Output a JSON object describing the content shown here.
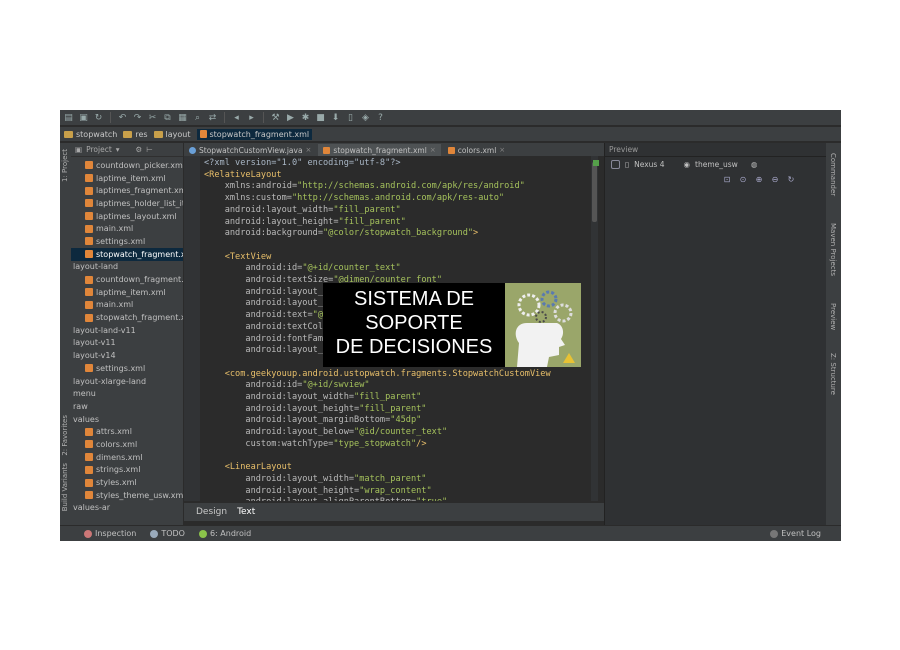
{
  "toolbar": {
    "icons": [
      "folder-icon",
      "save-icon",
      "sync-icon",
      "undo-icon",
      "redo-icon",
      "cut-icon",
      "copy-icon",
      "paste-icon",
      "find-icon",
      "replace-icon",
      "back-icon",
      "forward-icon",
      "build-icon",
      "run-icon",
      "debug-icon",
      "stop-icon",
      "sdk-icon",
      "avd-icon",
      "gradle-icon",
      "help-icon"
    ]
  },
  "breadcrumb": {
    "items": [
      "stopwatch",
      "res",
      "layout",
      "stopwatch_fragment.xml"
    ]
  },
  "left_tabs": {
    "project": "1: Project",
    "favorites": "2: Favorites",
    "build_variants": "Build Variants"
  },
  "project_panel": {
    "title": "Project",
    "items": [
      {
        "label": "countdown_picker.xml",
        "type": "file"
      },
      {
        "label": "laptime_item.xml",
        "type": "file"
      },
      {
        "label": "laptimes_fragment.xml",
        "type": "file"
      },
      {
        "label": "laptimes_holder_list_ite",
        "type": "file"
      },
      {
        "label": "laptimes_layout.xml",
        "type": "file"
      },
      {
        "label": "main.xml",
        "type": "file"
      },
      {
        "label": "settings.xml",
        "type": "file"
      },
      {
        "label": "stopwatch_fragment.xr",
        "type": "file",
        "selected": true
      },
      {
        "label": "layout-land",
        "type": "folder"
      },
      {
        "label": "countdown_fragment.x",
        "type": "file"
      },
      {
        "label": "laptime_item.xml",
        "type": "file"
      },
      {
        "label": "main.xml",
        "type": "file"
      },
      {
        "label": "stopwatch_fragment.xr",
        "type": "file"
      },
      {
        "label": "layout-land-v11",
        "type": "folder"
      },
      {
        "label": "layout-v11",
        "type": "folder"
      },
      {
        "label": "layout-v14",
        "type": "folder"
      },
      {
        "label": "settings.xml",
        "type": "file"
      },
      {
        "label": "layout-xlarge-land",
        "type": "folder"
      },
      {
        "label": "menu",
        "type": "folder"
      },
      {
        "label": "raw",
        "type": "folder"
      },
      {
        "label": "values",
        "type": "folder"
      },
      {
        "label": "attrs.xml",
        "type": "file"
      },
      {
        "label": "colors.xml",
        "type": "file"
      },
      {
        "label": "dimens.xml",
        "type": "file"
      },
      {
        "label": "strings.xml",
        "type": "file"
      },
      {
        "label": "styles.xml",
        "type": "file"
      },
      {
        "label": "styles_theme_usw.xml",
        "type": "file"
      },
      {
        "label": "values-ar",
        "type": "folder"
      }
    ]
  },
  "editor_tabs": [
    {
      "label": "StopwatchCustomView.java",
      "kind": "java"
    },
    {
      "label": "stopwatch_fragment.xml",
      "kind": "xml",
      "active": true
    },
    {
      "label": "colors.xml",
      "kind": "xml"
    }
  ],
  "code_lines": [
    [
      {
        "t": "<?xml version=\"1.0\" encoding=\"utf-8\"?>",
        "c": "plain"
      }
    ],
    [
      {
        "t": "<RelativeLayout",
        "c": "tag"
      }
    ],
    [
      {
        "t": "    xmlns:android=",
        "c": "attr"
      },
      {
        "t": "\"http://schemas.android.com/apk/res/android\"",
        "c": "val"
      }
    ],
    [
      {
        "t": "    xmlns:custom=",
        "c": "attr"
      },
      {
        "t": "\"http://schemas.android.com/apk/res-auto\"",
        "c": "val"
      }
    ],
    [
      {
        "t": "    android:layout_width=",
        "c": "attr"
      },
      {
        "t": "\"fill_parent\"",
        "c": "val"
      }
    ],
    [
      {
        "t": "    android:layout_height=",
        "c": "attr"
      },
      {
        "t": "\"fill_parent\"",
        "c": "val"
      }
    ],
    [
      {
        "t": "    android:background=",
        "c": "attr"
      },
      {
        "t": "\"@color/stopwatch_background\"",
        "c": "val"
      },
      {
        "t": ">",
        "c": "tag"
      }
    ],
    [
      {
        "t": "",
        "c": "plain"
      }
    ],
    [
      {
        "t": "    <TextView",
        "c": "tag"
      }
    ],
    [
      {
        "t": "        android:id=",
        "c": "attr"
      },
      {
        "t": "\"@+id/counter_text\"",
        "c": "val"
      }
    ],
    [
      {
        "t": "        android:textSize=",
        "c": "attr"
      },
      {
        "t": "\"@dimen/counter_font\"",
        "c": "val"
      }
    ],
    [
      {
        "t": "        android:layout_w",
        "c": "attr"
      }
    ],
    [
      {
        "t": "        android:layout_h",
        "c": "attr"
      }
    ],
    [
      {
        "t": "        android:text=",
        "c": "attr"
      },
      {
        "t": "\"@s",
        "c": "val"
      }
    ],
    [
      {
        "t": "        android:textColo",
        "c": "attr"
      }
    ],
    [
      {
        "t": "        android:fontFami",
        "c": "attr"
      }
    ],
    [
      {
        "t": "        android:layout_m",
        "c": "attr"
      }
    ],
    [
      {
        "t": "",
        "c": "plain"
      }
    ],
    [
      {
        "t": "    <com.geekyouup.android.ustopwatch.fragments.StopwatchCustomView",
        "c": "tag"
      }
    ],
    [
      {
        "t": "        android:id=",
        "c": "attr"
      },
      {
        "t": "\"@+id/swview\"",
        "c": "val"
      }
    ],
    [
      {
        "t": "        android:layout_width=",
        "c": "attr"
      },
      {
        "t": "\"fill_parent\"",
        "c": "val"
      }
    ],
    [
      {
        "t": "        android:layout_height=",
        "c": "attr"
      },
      {
        "t": "\"fill_parent\"",
        "c": "val"
      }
    ],
    [
      {
        "t": "        android:layout_marginBottom=",
        "c": "attr"
      },
      {
        "t": "\"45dp\"",
        "c": "val"
      }
    ],
    [
      {
        "t": "        android:layout_below=",
        "c": "attr"
      },
      {
        "t": "\"@id/counter_text\"",
        "c": "val"
      }
    ],
    [
      {
        "t": "        custom:watchType=",
        "c": "attr"
      },
      {
        "t": "\"type_stopwatch\"",
        "c": "val"
      },
      {
        "t": "/>",
        "c": "tag"
      }
    ],
    [
      {
        "t": "",
        "c": "plain"
      }
    ],
    [
      {
        "t": "    <LinearLayout",
        "c": "tag"
      }
    ],
    [
      {
        "t": "        android:layout_width=",
        "c": "attr"
      },
      {
        "t": "\"match_parent\"",
        "c": "val"
      }
    ],
    [
      {
        "t": "        android:layout_height=",
        "c": "attr"
      },
      {
        "t": "\"wrap_content\"",
        "c": "val"
      }
    ],
    [
      {
        "t": "        android:layout_alignParentBottom=",
        "c": "attr"
      },
      {
        "t": "\"true\"",
        "c": "val"
      }
    ]
  ],
  "bottom_tabs": {
    "design": "Design",
    "text": "Text"
  },
  "preview": {
    "title": "Preview",
    "device": "Nexus 4",
    "theme": "theme_usw"
  },
  "right_tabs": {
    "commander": "Commander",
    "maven": "Maven Projects",
    "preview": "Preview",
    "structure": "Z: Structure"
  },
  "statusbar": {
    "inspection": "Inspection",
    "todo": "TODO",
    "android": "6: Android",
    "event_log": "Event Log"
  },
  "overlay": {
    "line1": "SISTEMA DE",
    "line2": "SOPORTE",
    "line3": "DE DECISIONES"
  },
  "colors": {
    "ide_bg": "#2b2b2b",
    "panel_bg": "#3c3f41",
    "tag": "#e8bf6a",
    "value": "#a5c25c",
    "selection": "#0d293e"
  }
}
